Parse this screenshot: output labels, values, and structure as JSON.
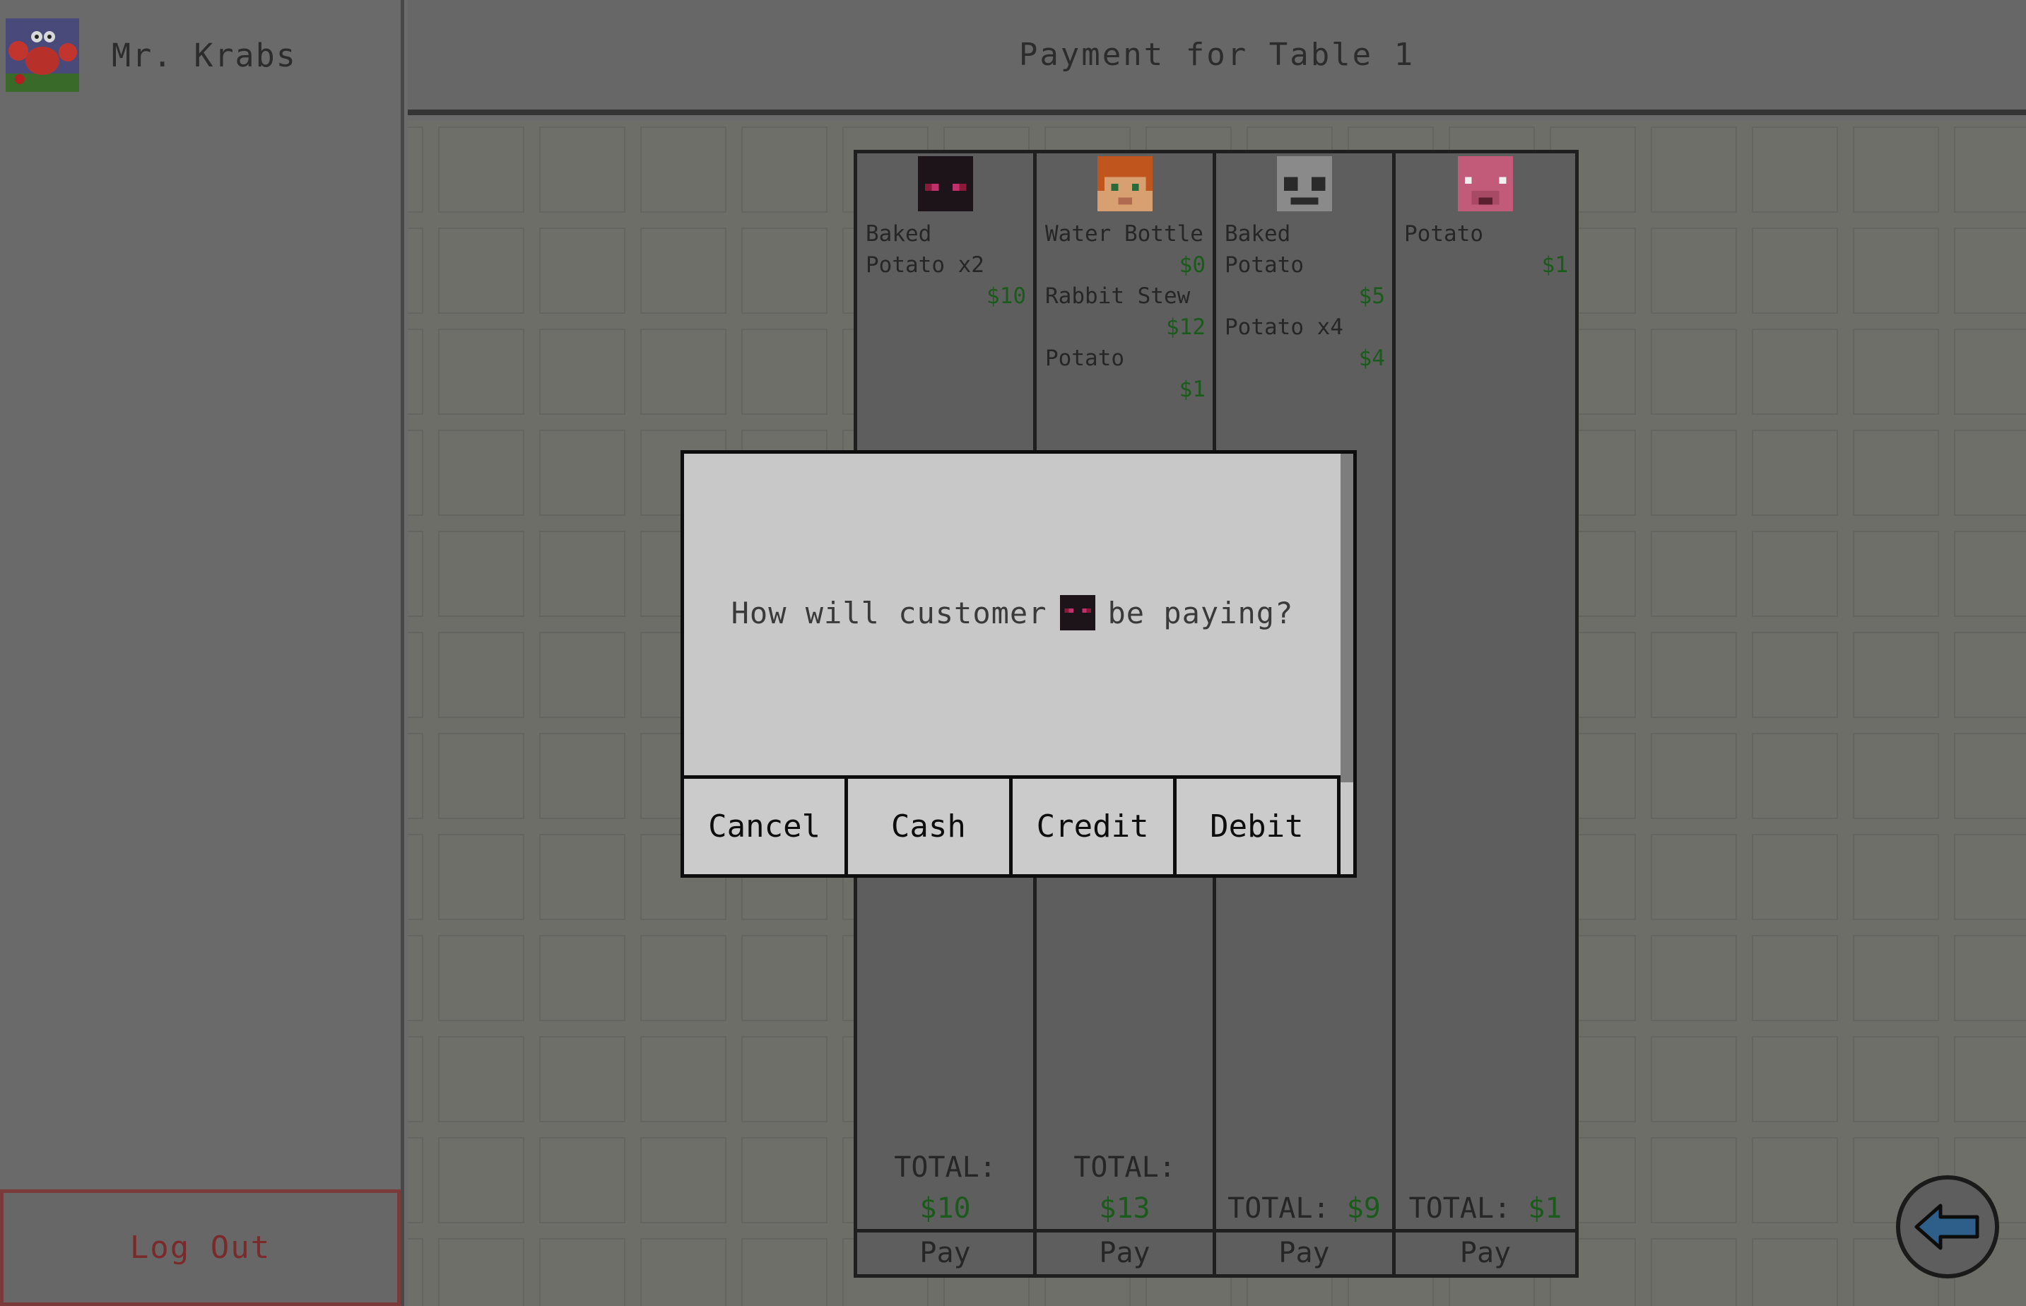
{
  "user": {
    "name": "Mr. Krabs",
    "avatar_icon": "mr-krabs-avatar-icon"
  },
  "sidebar": {
    "logout_label": "Log Out"
  },
  "header": {
    "title": "Payment for Table 1"
  },
  "orders": [
    {
      "customer_icon": "enderman-face-icon",
      "items": [
        {
          "name": "Baked\nPotato x2",
          "price": "$10"
        }
      ],
      "total_label": "TOTAL:",
      "total_amount": "$10",
      "pay_label": "Pay"
    },
    {
      "customer_icon": "alex-face-icon",
      "items": [
        {
          "name": "Water Bottle",
          "price": "$0"
        },
        {
          "name": "Rabbit Stew",
          "price": "$12"
        },
        {
          "name": "Potato",
          "price": "$1"
        }
      ],
      "total_label": "TOTAL:",
      "total_amount": "$13",
      "pay_label": "Pay"
    },
    {
      "customer_icon": "skeleton-face-icon",
      "items": [
        {
          "name": "Baked\nPotato",
          "price": "$5"
        },
        {
          "name": "Potato x4",
          "price": "$4"
        }
      ],
      "total_label": "TOTAL:",
      "total_amount": "$9",
      "pay_label": "Pay"
    },
    {
      "customer_icon": "pig-face-icon",
      "items": [
        {
          "name": "Potato",
          "price": "$1"
        }
      ],
      "total_label": "TOTAL:",
      "total_amount": "$1",
      "pay_label": "Pay"
    }
  ],
  "modal": {
    "message_before": "How will customer",
    "message_after": "be paying?",
    "customer_icon": "enderman-face-icon",
    "buttons": [
      "Cancel",
      "Cash",
      "Credit",
      "Debit"
    ]
  },
  "nav": {
    "back_icon": "back-arrow-icon"
  },
  "colors": {
    "price_green": "#1a5a1a",
    "logout_red": "#7a2a2a",
    "overlay_gray": "#6b6b6b",
    "modal_bg": "#c8c8c8"
  }
}
